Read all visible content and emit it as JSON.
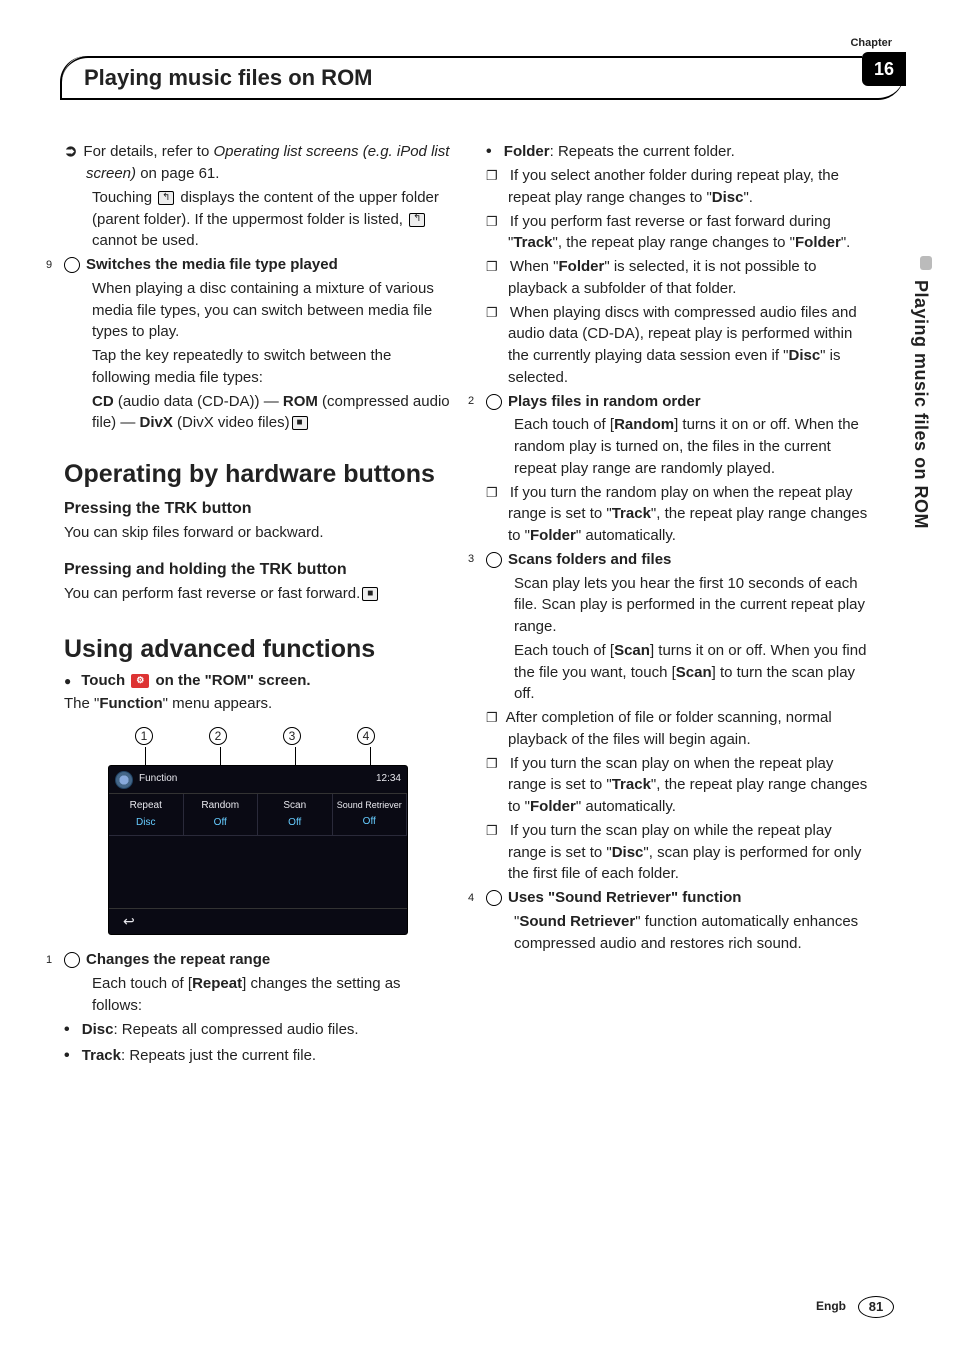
{
  "chapter": {
    "label": "Chapter",
    "number": "16"
  },
  "page_title": "Playing music files on ROM",
  "side_tab": "Playing music files on ROM",
  "footer": {
    "lang": "Engb",
    "page": "81"
  },
  "left": {
    "ref1a": "For details, refer to ",
    "ref1b": "Operating list screens (e.g. iPod list screen)",
    "ref1c": " on page 61.",
    "touch1": "Touching ",
    "touch2": " displays the content of the upper folder (parent folder). If the uppermost folder is listed, ",
    "touch3": " cannot be used.",
    "item9_title": "Switches the media file type played",
    "item9_p1": "When playing a disc containing a mixture of various media file types, you can switch between media file types to play.",
    "item9_p2": "Tap the key repeatedly to switch between the following media file types:",
    "item9_p3a": "CD",
    "item9_p3b": " (audio data (CD-DA)) — ",
    "item9_p3c": "ROM",
    "item9_p3d": " (compressed audio file) — ",
    "item9_p3e": "DivX",
    "item9_p3f": " (DivX video files)",
    "h_operating": "Operating by hardware buttons",
    "h_press": "Pressing the TRK button",
    "press_p": "You can skip files forward or backward.",
    "h_hold": "Pressing and holding the TRK button",
    "hold_p": "You can perform fast reverse or fast forward.",
    "h_adv": "Using advanced functions",
    "adv_action_a": "Touch ",
    "adv_action_b": " on the \"ROM\" screen.",
    "adv_p": "The \"",
    "adv_p_b": "Function",
    "adv_p_c": "\" menu appears.",
    "item1_title": "Changes the repeat range",
    "item1_p1a": "Each touch of [",
    "item1_p1b": "Repeat",
    "item1_p1c": "] changes the setting as follows:",
    "item1_b1a": "Disc",
    "item1_b1b": ": Repeats all compressed audio files.",
    "item1_b2a": "Track",
    "item1_b2b": ": Repeats just the current file."
  },
  "shot": {
    "top_label": "Function",
    "time": "12:34",
    "cells": [
      {
        "hdr": "Repeat",
        "val": "Disc"
      },
      {
        "hdr": "Random",
        "val": "Off"
      },
      {
        "hdr": "Scan",
        "val": "Off"
      },
      {
        "hdr": "Sound Retriever",
        "val": "Off"
      }
    ],
    "back": "↩"
  },
  "right": {
    "b1a": "Folder",
    "b1b": ": Repeats the current folder.",
    "sq1a": "If you select another folder during repeat play, the repeat play range changes to \"",
    "sq1b": "Disc",
    "sq1c": "\".",
    "sq2a": "If you perform fast reverse or fast forward during \"",
    "sq2b": "Track",
    "sq2c": "\", the repeat play range changes to \"",
    "sq2d": "Folder",
    "sq2e": "\".",
    "sq3a": "When \"",
    "sq3b": "Folder",
    "sq3c": "\" is selected, it is not possible to playback a subfolder of that folder.",
    "sq4a": "When playing discs with compressed audio files and audio data (CD-DA), repeat play is performed within the currently playing data session even if \"",
    "sq4b": "Disc",
    "sq4c": "\" is selected.",
    "item2_title": "Plays files in random order",
    "item2_p1a": "Each touch of [",
    "item2_p1b": "Random",
    "item2_p1c": "] turns it on or off. When the random play is turned on, the files in the current repeat play range are randomly played.",
    "item2_sq1a": "If you turn the random play on when the repeat play range is set to \"",
    "item2_sq1b": "Track",
    "item2_sq1c": "\", the repeat play range changes to \"",
    "item2_sq1d": "Folder",
    "item2_sq1e": "\" automatically.",
    "item3_title": "Scans folders and files",
    "item3_p1": "Scan play lets you hear the first 10 seconds of each file. Scan play is performed in the current repeat play range.",
    "item3_p2a": "Each touch of [",
    "item3_p2b": "Scan",
    "item3_p2c": "] turns it on or off. When you find the file you want, touch [",
    "item3_p2d": "Scan",
    "item3_p2e": "] to turn the scan play off.",
    "item3_sq1": "After completion of file or folder scanning, normal playback of the files will begin again.",
    "item3_sq2a": "If you turn the scan play on when the repeat play range is set to \"",
    "item3_sq2b": "Track",
    "item3_sq2c": "\", the repeat play range changes to \"",
    "item3_sq2d": "Folder",
    "item3_sq2e": "\" automatically.",
    "item3_sq3a": "If you turn the scan play on while the repeat play range is set to \"",
    "item3_sq3b": "Disc",
    "item3_sq3c": "\", scan play is performed for only the first file of each folder.",
    "item4_title": "Uses \"Sound Retriever\" function",
    "item4_p1a": "\"",
    "item4_p1b": "Sound Retriever",
    "item4_p1c": "\" function automatically enhances compressed audio and restores rich sound."
  }
}
